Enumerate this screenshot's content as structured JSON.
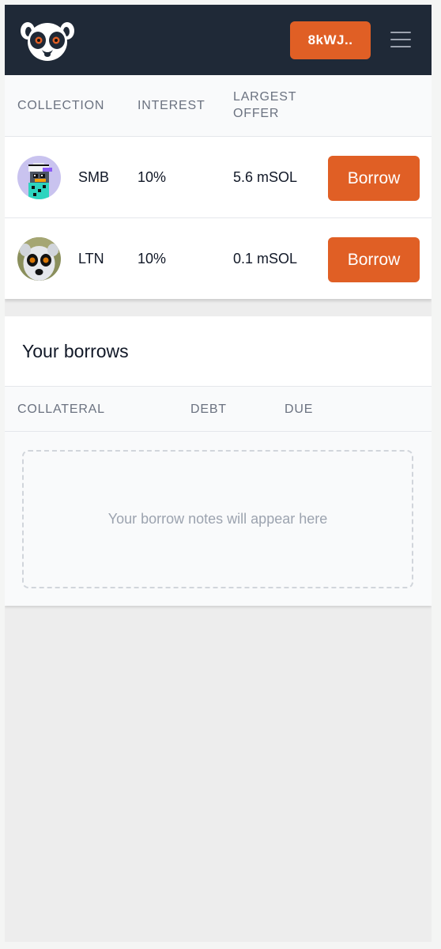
{
  "navbar": {
    "wallet_label": "8kWJ..",
    "logo_icon": "lemur-logo-icon",
    "menu_icon": "hamburger-menu-icon"
  },
  "offers_table": {
    "headers": {
      "collection": "COLLECTION",
      "interest": "INTEREST",
      "largest_offer_line1": "LARGEST",
      "largest_offer_line2": "OFFER"
    },
    "rows": [
      {
        "collection": "SMB",
        "interest": "10%",
        "largest_offer": "5.6 mSOL",
        "action_label": "Borrow",
        "avatar_icon": "smb-pixel-avatar"
      },
      {
        "collection": "LTN",
        "interest": "10%",
        "largest_offer": "0.1 mSOL",
        "action_label": "Borrow",
        "avatar_icon": "lemur-photo-avatar"
      }
    ]
  },
  "borrows": {
    "title": "Your borrows",
    "headers": {
      "collateral": "COLLATERAL",
      "debt": "DEBT",
      "due": "DUE"
    },
    "empty_message": "Your borrow notes will appear here"
  },
  "colors": {
    "accent": "#e05f25",
    "navbar_bg": "#1f2937",
    "muted_text": "#6b7280",
    "page_bg": "#ededed"
  }
}
